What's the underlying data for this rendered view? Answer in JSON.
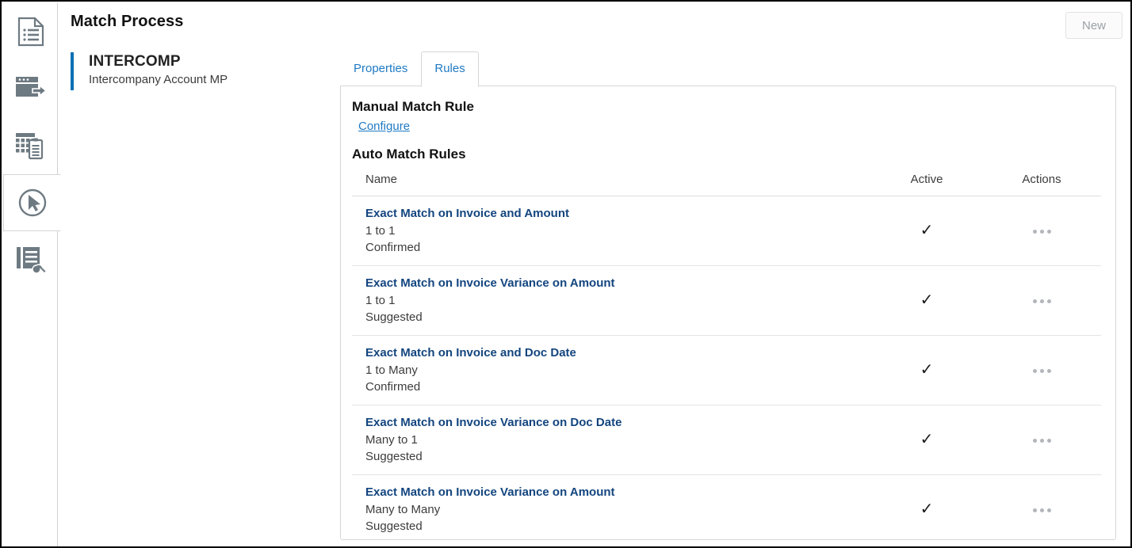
{
  "header": {
    "title": "Match Process",
    "new_label": "New"
  },
  "sidebar": {
    "items": [
      {
        "icon": "document-list-icon",
        "selected": false
      },
      {
        "icon": "window-export-icon",
        "selected": false
      },
      {
        "icon": "grid-clipboard-icon",
        "selected": false
      },
      {
        "icon": "cursor-circle-icon",
        "selected": true
      },
      {
        "icon": "document-wrench-icon",
        "selected": false
      }
    ]
  },
  "entity": {
    "code": "INTERCOMP",
    "description": "Intercompany Account MP",
    "accent_color": "#0a70b5"
  },
  "tabs": [
    {
      "label": "Properties",
      "active": false
    },
    {
      "label": "Rules",
      "active": true
    }
  ],
  "panel": {
    "manual_heading": "Manual Match Rule",
    "configure_label": "Configure",
    "auto_heading": "Auto Match Rules",
    "columns": {
      "name": "Name",
      "active": "Active",
      "actions": "Actions"
    },
    "rows": [
      {
        "name": "Exact Match on Invoice and Amount",
        "cardinality": "1 to 1",
        "status": "Confirmed",
        "active": "✓",
        "actions": "more-actions-icon"
      },
      {
        "name": "Exact Match on Invoice Variance on Amount",
        "cardinality": "1 to 1",
        "status": "Suggested",
        "active": "✓",
        "actions": "more-actions-icon"
      },
      {
        "name": "Exact Match on Invoice and Doc Date",
        "cardinality": "1 to Many",
        "status": "Confirmed",
        "active": "✓",
        "actions": "more-actions-icon"
      },
      {
        "name": "Exact Match on Invoice Variance on Doc Date",
        "cardinality": "Many to 1",
        "status": "Suggested",
        "active": "✓",
        "actions": "more-actions-icon"
      },
      {
        "name": "Exact Match on Invoice Variance on Amount",
        "cardinality": "Many to Many",
        "status": "Suggested",
        "active": "✓",
        "actions": "more-actions-icon"
      }
    ]
  },
  "colors": {
    "link": "#1f7ac4",
    "rule_link": "#13457f",
    "accent": "#0a70b5",
    "icon_grey": "#6e7a82"
  }
}
